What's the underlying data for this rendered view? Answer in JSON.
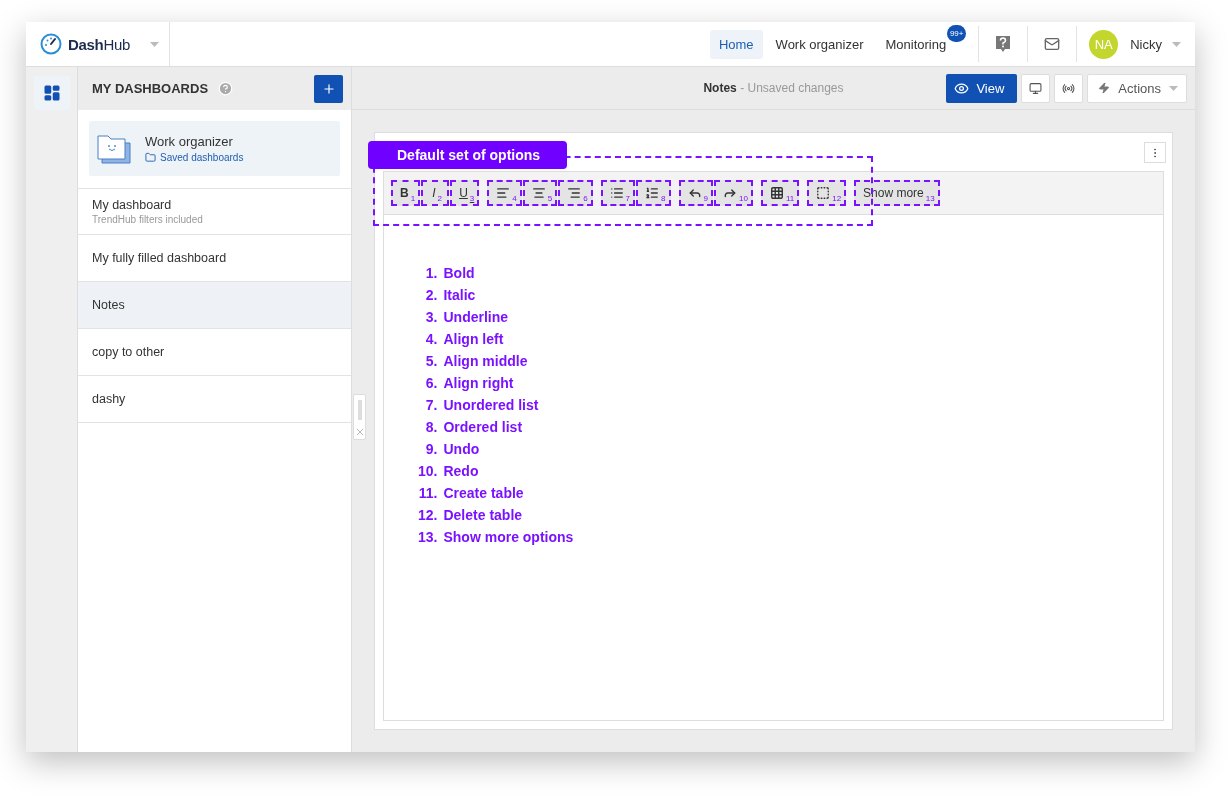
{
  "app": {
    "logo": "**Dash**Hub"
  },
  "nav": {
    "items": [
      {
        "label": "Home",
        "selected": true
      },
      {
        "label": "Work organizer",
        "selected": false
      },
      {
        "label": "Monitoring",
        "selected": false,
        "badge": "99+"
      }
    ],
    "user": {
      "initials": "NA",
      "name": "Nicky"
    }
  },
  "sidebar": {
    "title": "MY DASHBOARDS",
    "items": [
      {
        "kind": "card",
        "title": "Work organizer",
        "link": "Saved dashboards",
        "selected": false
      },
      {
        "kind": "row",
        "title": "My dashboard",
        "subtitle": "TrendHub filters included",
        "selected": false
      },
      {
        "kind": "row",
        "title": "My fully filled dashboard",
        "selected": false
      },
      {
        "kind": "row",
        "title": "Notes",
        "selected": true
      },
      {
        "kind": "row",
        "title": "copy to other",
        "selected": false
      },
      {
        "kind": "row",
        "title": "dashy",
        "selected": false
      }
    ]
  },
  "header": {
    "title": "Notes",
    "status": "- Unsaved changes",
    "view": "View",
    "actions": "Actions"
  },
  "editor": {
    "annotation": "Default set of options",
    "toolbar": [
      [
        {
          "kind": "bold",
          "label": "B",
          "marker": "1"
        },
        {
          "kind": "italic",
          "label": "I",
          "marker": "2"
        },
        {
          "kind": "underline",
          "label": "U",
          "marker": "3"
        }
      ],
      [
        {
          "kind": "align-left",
          "marker": "4"
        },
        {
          "kind": "align-center",
          "marker": "5"
        },
        {
          "kind": "align-right",
          "marker": "6"
        }
      ],
      [
        {
          "kind": "bullet-list",
          "marker": "7"
        },
        {
          "kind": "numbered-list",
          "marker": "8"
        }
      ],
      [
        {
          "kind": "undo",
          "marker": "9"
        },
        {
          "kind": "redo",
          "marker": "10"
        }
      ],
      [
        {
          "kind": "table",
          "marker": "11"
        }
      ],
      [
        {
          "kind": "delete-table",
          "marker": "12"
        }
      ],
      [
        {
          "kind": "text",
          "label": "Show more",
          "marker": "13"
        }
      ]
    ],
    "list": [
      {
        "number": "1.",
        "text": "Bold"
      },
      {
        "number": "2.",
        "text": "Italic"
      },
      {
        "number": "3.",
        "text": "Underline"
      },
      {
        "number": "4.",
        "text": "Align left"
      },
      {
        "number": "5.",
        "text": "Align middle"
      },
      {
        "number": "6.",
        "text": "Align right"
      },
      {
        "number": "7.",
        "text": "Unordered list"
      },
      {
        "number": "8.",
        "text": "Ordered list"
      },
      {
        "number": "9.",
        "text": "Undo"
      },
      {
        "number": "10.",
        "text": "Redo"
      },
      {
        "number": "11.",
        "text": "Create table"
      },
      {
        "number": "12.",
        "text": "Delete table"
      },
      {
        "number": "13.",
        "text": "Show more options"
      }
    ]
  }
}
